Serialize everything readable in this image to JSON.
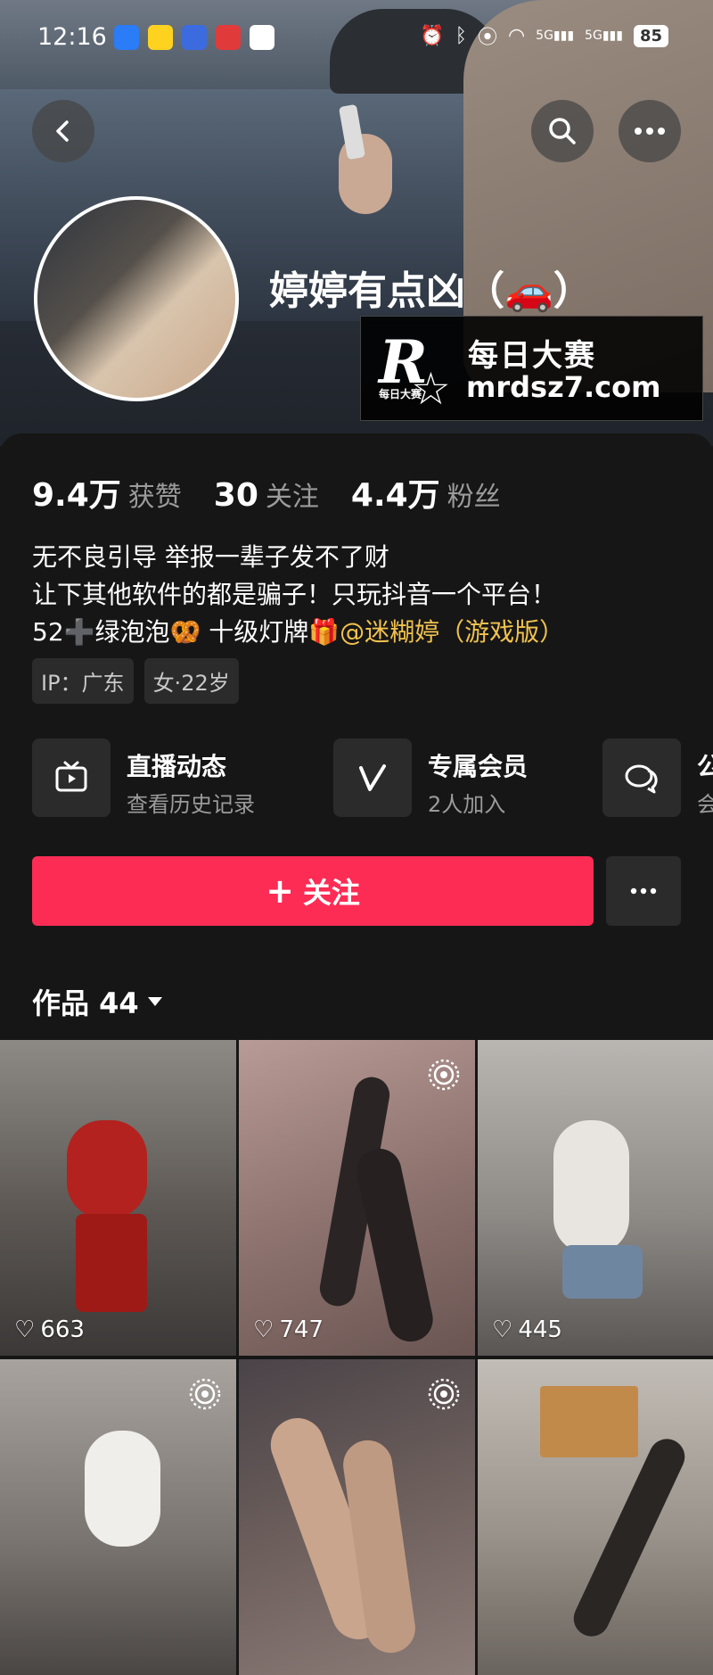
{
  "status_bar": {
    "time": "12:16",
    "battery": "85",
    "network_1": "5G",
    "network_2": "5G"
  },
  "profile": {
    "nickname": "婷婷有点凶（🚗）"
  },
  "watermark": {
    "logo_letter": "R",
    "logo_sub": "每日大赛",
    "title": "每日大赛",
    "url": "mrdsz7.com"
  },
  "stats": [
    {
      "value": "9.4万",
      "label": "获赞"
    },
    {
      "value": "30",
      "label": "关注"
    },
    {
      "value": "4.4万",
      "label": "粉丝"
    }
  ],
  "bio": {
    "line1": "无不良引导  举报一辈子发不了财",
    "line2": "让下其他软件的都是骗子！只玩抖音一个平台！",
    "line3_prefix": "52➕绿泡泡🥨  十级灯牌🎁",
    "line3_link": "@迷糊婷（游戏版）"
  },
  "tags": [
    "IP：广东",
    "女·22岁"
  ],
  "features": [
    {
      "title": "直播动态",
      "subtitle": "查看历史记录",
      "icon": "tv-icon"
    },
    {
      "title": "专属会员",
      "subtitle": "2人加入",
      "icon": "v-icon"
    },
    {
      "title": "公",
      "subtitle": "会",
      "icon": "chat-icon"
    }
  ],
  "actions": {
    "follow": "关注"
  },
  "works": {
    "label": "作品 44"
  },
  "videos": [
    {
      "likes": "663",
      "live": false
    },
    {
      "likes": "747",
      "live": true
    },
    {
      "likes": "445",
      "live": false
    },
    {
      "likes": "",
      "live": true
    },
    {
      "likes": "",
      "live": true
    },
    {
      "likes": "",
      "live": false
    }
  ],
  "colors": {
    "follow": "#fc2c55",
    "link": "#f1c24e",
    "background": "#161616"
  }
}
